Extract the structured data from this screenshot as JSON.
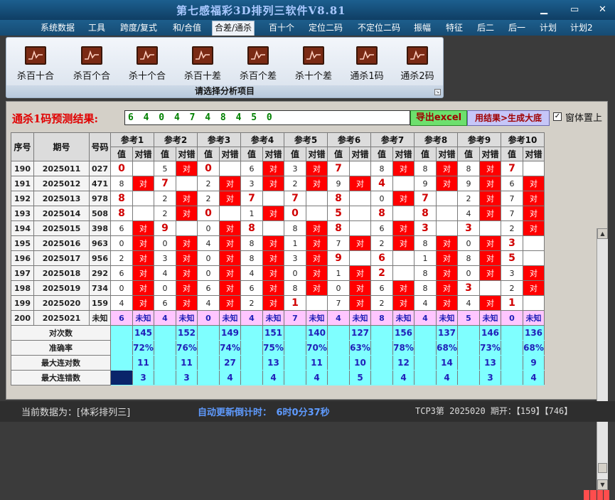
{
  "title": "第七感福彩3D排列三软件V8.81",
  "window_controls": {
    "minimize": "▁",
    "maximize": "▭",
    "close": "✕"
  },
  "menu": [
    "系统数据",
    "工具",
    "跨度/复式",
    "和/合值",
    "合差/通杀",
    "百十个",
    "定位二码",
    "不定位二码",
    "振幅",
    "特征",
    "后二",
    "后一",
    "计划",
    "计划2"
  ],
  "menu_active": "合差/通杀",
  "ribbon": {
    "buttons": [
      "杀百十合",
      "杀百个合",
      "杀十个合",
      "杀百十差",
      "杀百个差",
      "杀十个差",
      "通杀1码",
      "通杀2码"
    ],
    "icon": "chart-icon",
    "caption": "请选择分析项目"
  },
  "prediction": {
    "label": "通杀1码预测结果:",
    "value": "6 4 0 4 7 4 8 4 5 0",
    "excel_button": "导出excel",
    "generate_button": "用结果>生成大底",
    "checkbox_checked": true,
    "checkbox_mark": "✓",
    "checkbox_label": "窗体置上"
  },
  "table": {
    "headers": [
      "序号",
      "期号",
      "号码"
    ],
    "ref_headers": [
      "参考1",
      "参考2",
      "参考3",
      "参考4",
      "参考5",
      "参考6",
      "参考7",
      "参考8",
      "参考9",
      "参考10"
    ],
    "sub_headers": [
      "值",
      "对错"
    ],
    "hit_text": "对",
    "rows": [
      {
        "seq": "190",
        "issue": "2025011",
        "num": "027",
        "vals": [
          "0",
          "5",
          "0",
          "6",
          "3",
          "7",
          "8",
          "8",
          "8",
          "7"
        ],
        "hits": [
          0,
          1,
          0,
          1,
          1,
          0,
          1,
          1,
          1,
          0
        ]
      },
      {
        "seq": "191",
        "issue": "2025012",
        "num": "471",
        "vals": [
          "8",
          "7",
          "2",
          "3",
          "2",
          "9",
          "4",
          "9",
          "9",
          "6"
        ],
        "hits": [
          1,
          0,
          1,
          1,
          1,
          1,
          0,
          1,
          1,
          1
        ]
      },
      {
        "seq": "192",
        "issue": "2025013",
        "num": "978",
        "vals": [
          "8",
          "2",
          "2",
          "7",
          "7",
          "8",
          "0",
          "7",
          "2",
          "7"
        ],
        "hits": [
          0,
          1,
          1,
          0,
          0,
          0,
          1,
          0,
          1,
          1
        ]
      },
      {
        "seq": "193",
        "issue": "2025014",
        "num": "508",
        "vals": [
          "8",
          "2",
          "0",
          "1",
          "0",
          "5",
          "8",
          "8",
          "4",
          "7"
        ],
        "hits": [
          0,
          1,
          0,
          1,
          0,
          0,
          0,
          0,
          1,
          1
        ]
      },
      {
        "seq": "194",
        "issue": "2025015",
        "num": "398",
        "vals": [
          "6",
          "9",
          "0",
          "8",
          "8",
          "8",
          "6",
          "3",
          "3",
          "2"
        ],
        "hits": [
          1,
          0,
          1,
          0,
          1,
          0,
          1,
          0,
          0,
          1
        ]
      },
      {
        "seq": "195",
        "issue": "2025016",
        "num": "963",
        "vals": [
          "0",
          "0",
          "4",
          "8",
          "1",
          "7",
          "2",
          "8",
          "0",
          "3"
        ],
        "hits": [
          1,
          1,
          1,
          1,
          1,
          1,
          1,
          1,
          1,
          0
        ]
      },
      {
        "seq": "196",
        "issue": "2025017",
        "num": "956",
        "vals": [
          "2",
          "3",
          "0",
          "8",
          "3",
          "9",
          "6",
          "1",
          "8",
          "5"
        ],
        "hits": [
          1,
          1,
          1,
          1,
          1,
          0,
          0,
          1,
          1,
          0
        ]
      },
      {
        "seq": "197",
        "issue": "2025018",
        "num": "292",
        "vals": [
          "6",
          "4",
          "0",
          "4",
          "0",
          "1",
          "2",
          "8",
          "0",
          "3"
        ],
        "hits": [
          1,
          1,
          1,
          1,
          1,
          1,
          0,
          1,
          1,
          1
        ]
      },
      {
        "seq": "198",
        "issue": "2025019",
        "num": "734",
        "vals": [
          "0",
          "0",
          "6",
          "6",
          "8",
          "0",
          "6",
          "8",
          "3",
          "2"
        ],
        "hits": [
          1,
          1,
          1,
          1,
          1,
          1,
          1,
          1,
          0,
          1
        ]
      },
      {
        "seq": "199",
        "issue": "2025020",
        "num": "159",
        "vals": [
          "4",
          "6",
          "4",
          "2",
          "1",
          "7",
          "2",
          "4",
          "4",
          "1"
        ],
        "hits": [
          1,
          1,
          1,
          1,
          0,
          1,
          1,
          1,
          1,
          0
        ]
      }
    ],
    "pending": {
      "seq": "200",
      "issue": "2025021",
      "num": "未知",
      "vals": [
        "6",
        "4",
        "0",
        "4",
        "7",
        "4",
        "8",
        "4",
        "5",
        "0"
      ],
      "status": "未知"
    },
    "stats": [
      {
        "label": "对次数",
        "values": [
          "145",
          "152",
          "149",
          "151",
          "140",
          "127",
          "156",
          "137",
          "146",
          "136"
        ]
      },
      {
        "label": "准确率",
        "values": [
          "72%",
          "76%",
          "74%",
          "75%",
          "70%",
          "63%",
          "78%",
          "68%",
          "73%",
          "68%"
        ]
      },
      {
        "label": "最大连对数",
        "values": [
          "11",
          "11",
          "27",
          "13",
          "11",
          "10",
          "12",
          "14",
          "13",
          "9"
        ]
      },
      {
        "label": "最大连错数",
        "values": [
          "3",
          "3",
          "4",
          "4",
          "4",
          "5",
          "4",
          "4",
          "3",
          "4"
        ]
      }
    ]
  },
  "status": {
    "current_data": "当前数据为：[体彩排列三]",
    "countdown": "自动更新倒计时：　6时0分37秒",
    "info": "TCP3第 2025020 期开：【159】【746】"
  }
}
